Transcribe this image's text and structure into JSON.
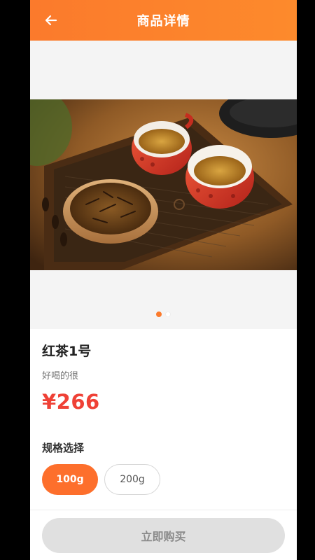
{
  "header": {
    "title": "商品详情",
    "back_icon": "arrow-left-icon"
  },
  "gallery": {
    "image_subject": "red tea cups with loose tea leaves on wooden tray",
    "slide_count": 2,
    "active_slide": 1
  },
  "product": {
    "name": "红茶1号",
    "description": "好喝的很",
    "price": "¥266"
  },
  "spec": {
    "title": "规格选择",
    "options": [
      {
        "label": "100g",
        "selected": true
      },
      {
        "label": "200g",
        "selected": false
      }
    ]
  },
  "bottom": {
    "buy_label": "立即购买"
  },
  "colors": {
    "accent": "#fb7a2c",
    "price": "#ef4136",
    "button_disabled": "#e0e0e0"
  }
}
